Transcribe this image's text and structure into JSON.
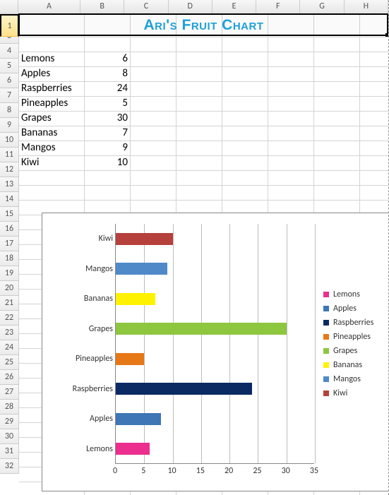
{
  "columns": [
    "A",
    "B",
    "C",
    "D",
    "E",
    "F",
    "G",
    "H"
  ],
  "title": "Ari's Fruit Chart",
  "rows": [
    {
      "label": "Lemons",
      "value": 6
    },
    {
      "label": "Apples",
      "value": 8
    },
    {
      "label": "Raspberries",
      "value": 24
    },
    {
      "label": "Pineapples",
      "value": 5
    },
    {
      "label": "Grapes",
      "value": 30
    },
    {
      "label": "Bananas",
      "value": 7
    },
    {
      "label": "Mangos",
      "value": 9
    },
    {
      "label": "Kiwi",
      "value": 10
    }
  ],
  "colors": {
    "Lemons": "#ec2e8f",
    "Apples": "#3e76b6",
    "Raspberries": "#0b2a63",
    "Pineapples": "#e77817",
    "Grapes": "#8dc63f",
    "Bananas": "#fff200",
    "Mangos": "#4f89c8",
    "Kiwi": "#b5403c"
  },
  "chart_data": {
    "type": "bar",
    "orientation": "horizontal",
    "categories": [
      "Lemons",
      "Apples",
      "Raspberries",
      "Pineapples",
      "Grapes",
      "Bananas",
      "Mangos",
      "Kiwi"
    ],
    "values": [
      6,
      8,
      24,
      5,
      30,
      7,
      9,
      10
    ],
    "xlim": [
      0,
      35
    ],
    "xticks": [
      0,
      5,
      10,
      15,
      20,
      25,
      30,
      35
    ],
    "legend": [
      "Lemons",
      "Apples",
      "Raspberries",
      "Pineapples",
      "Grapes",
      "Bananas",
      "Mangos",
      "Kiwi"
    ]
  }
}
